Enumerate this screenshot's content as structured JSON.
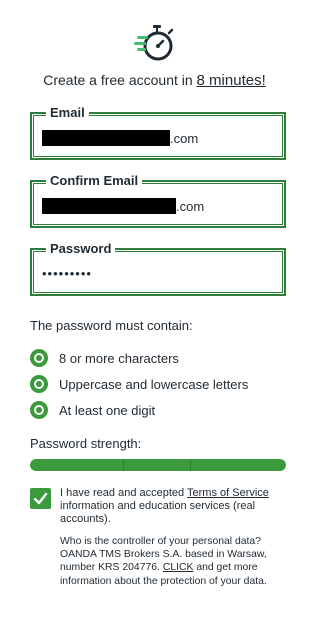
{
  "header": {
    "headline_prefix": "Create a free account in ",
    "headline_highlight": "8 minutes!"
  },
  "form": {
    "email": {
      "label": "Email",
      "value_suffix": ".com"
    },
    "confirm_email": {
      "label": "Confirm Email",
      "value_suffix": ".com"
    },
    "password": {
      "label": "Password",
      "value": "•••••••••"
    }
  },
  "requirements": {
    "title": "The password must contain:",
    "items": [
      {
        "label": "8 or more characters"
      },
      {
        "label": "Uppercase and lowercase letters"
      },
      {
        "label": "At least one digit"
      }
    ]
  },
  "strength": {
    "label": "Password strength:",
    "level": 1.0
  },
  "consent": {
    "checked": true,
    "text_prefix": "I have read and accepted ",
    "terms_link": "Terms of Service",
    "text_suffix": " information and education services (real accounts)."
  },
  "privacy": {
    "text_prefix": "Who is the controller of your personal data? OANDA TMS Brokers S.A. based in Warsaw, number KRS 204776. ",
    "click_link": "CLICK",
    "text_suffix": " and get more information about the protection of your data."
  },
  "colors": {
    "accent_green": "#3a9a3c",
    "border_green": "#2e7d3a",
    "text_dark": "#1f2a33"
  }
}
